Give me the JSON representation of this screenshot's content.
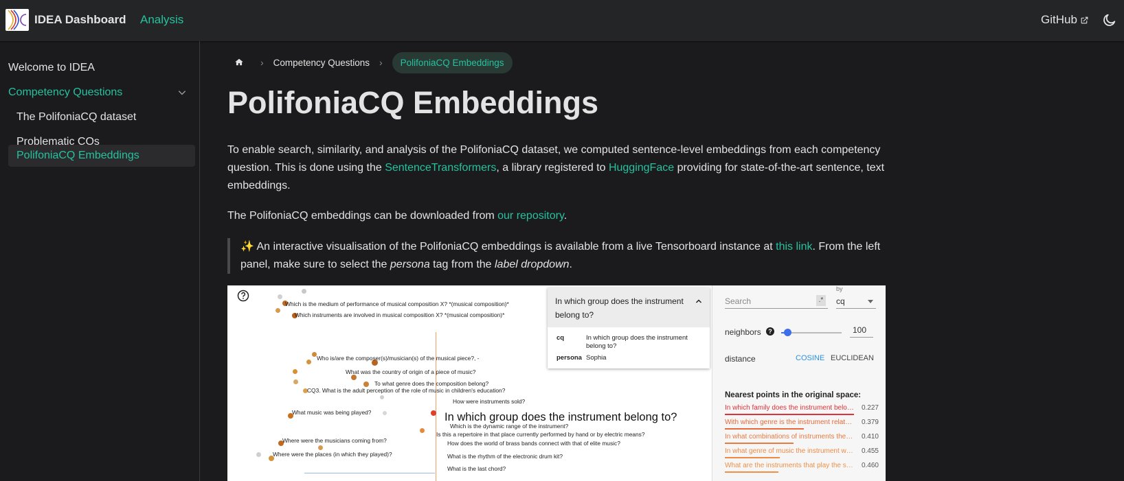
{
  "navbar": {
    "brand": "IDEA Dashboard",
    "analysis": "Analysis",
    "github": "GitHub",
    "accent": "#25c2a0"
  },
  "sidebar": {
    "items": [
      {
        "label": "Welcome to IDEA"
      },
      {
        "label": "Competency Questions"
      },
      {
        "label": "The PolifoniaCQ dataset"
      },
      {
        "label": "Problematic CQs"
      },
      {
        "label": "PolifoniaCQ Embeddings"
      }
    ]
  },
  "breadcrumb": {
    "items": [
      "Competency Questions",
      "PolifoniaCQ Embeddings"
    ]
  },
  "main": {
    "title": "PolifoniaCQ Embeddings",
    "p1": {
      "a": "To enable search, similarity, and analysis of the PolifoniaCQ dataset, we computed sentence-level embeddings from each competency question. This is done using the ",
      "link1": "SentenceTransformers",
      "b": ", a library registered to ",
      "link2": "HuggingFace",
      "c": " providing for state-of-the-art sentence, text embeddings."
    },
    "p2": {
      "a": "The PolifoniaCQ embeddings can be downloaded from ",
      "link": "our repository",
      "b": "."
    },
    "note": {
      "icon": "✨",
      "a": " An interactive visualisation of the PolifoniaCQ embeddings is available from a live Tensorboard instance at ",
      "link": "this link",
      "b": ". From the left panel, make sure to select the ",
      "em1": "persona",
      "c": " tag from the ",
      "em2": "label dropdown",
      "d": "."
    }
  },
  "projector": {
    "labels": [
      "Which is the medium of performance of musical composition X? *(musical composition)*",
      "Which instruments are involved in musical composition X? *(musical composition)*",
      "Who is/are the composer(s)/musician(s) of the musical piece?, -",
      "What was the country of origin of a piece of music?",
      "To what genre does the composition belong?",
      "CQ3. What is the adult perception of the role of music in children's education?",
      "How were instruments sold?",
      "What music was being played?",
      "Which is the dynamic range of the instrument?",
      "Is this a repertoire in that place currently performed by hand or by electric means?",
      "Where were the musicians coming from?",
      "How does the world of brass bands connect with that of elite music?",
      "Where were the places (in which they played)?",
      "What is the rhythm of the electronic drum kit?",
      "What is the last chord?"
    ],
    "selected_label": "In which group does the instrument belong to?",
    "card": {
      "title": "In which group does the instrument belong to?",
      "cq_key": "cq",
      "cq_val": "In which group does the instrument belong to?",
      "persona_key": "persona",
      "persona_val": "Sophia"
    },
    "search_placeholder": "Search",
    "regex_label": ".*",
    "by_label": "by",
    "by_value": "cq",
    "neighbors_label": "neighbors",
    "neighbors_value": "100",
    "distance_label": "distance",
    "cosine": "COSINE",
    "euclidean": "EUCLIDEAN",
    "nearest_title": "Nearest points in the original space:",
    "nearest": [
      {
        "text": "In which family does the instrument belong to?",
        "value": "0.227"
      },
      {
        "text": "With which genre is the instrument related?",
        "value": "0.379"
      },
      {
        "text": "In what combinations of instruments the instrument is used?",
        "value": "0.410"
      },
      {
        "text": "In what genre of music the instrument was used?",
        "value": "0.455"
      },
      {
        "text": "What are the instruments that play the same role?",
        "value": "0.460"
      }
    ]
  }
}
